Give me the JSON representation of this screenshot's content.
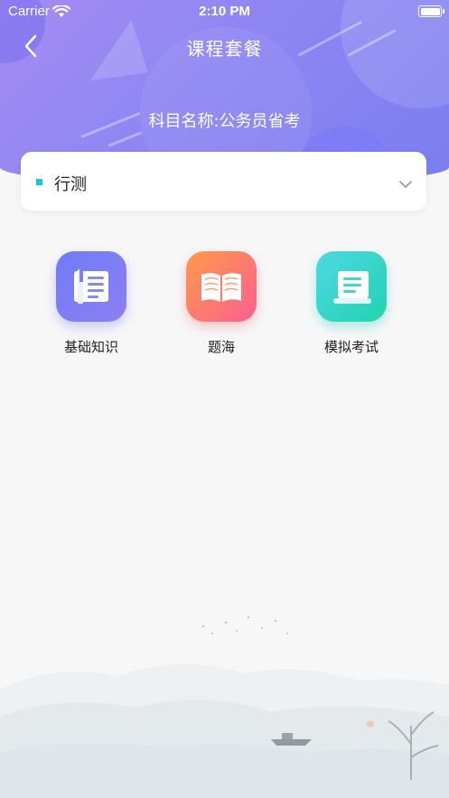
{
  "status_bar": {
    "carrier": "Carrier",
    "time": "2:10 PM"
  },
  "nav": {
    "title": "课程套餐"
  },
  "subject_line": "科目名称:公务员省考",
  "category_select": {
    "selected": "行测"
  },
  "features": [
    {
      "label": "基础知识",
      "icon": "book-list-icon"
    },
    {
      "label": "题海",
      "icon": "open-book-icon"
    },
    {
      "label": "模拟考试",
      "icon": "scroll-icon"
    }
  ],
  "colors": {
    "header_start": "#a58cf2",
    "header_end": "#7b7ef0",
    "select_marker": "#19c2ee",
    "page_bg": "#f7f7f8"
  }
}
